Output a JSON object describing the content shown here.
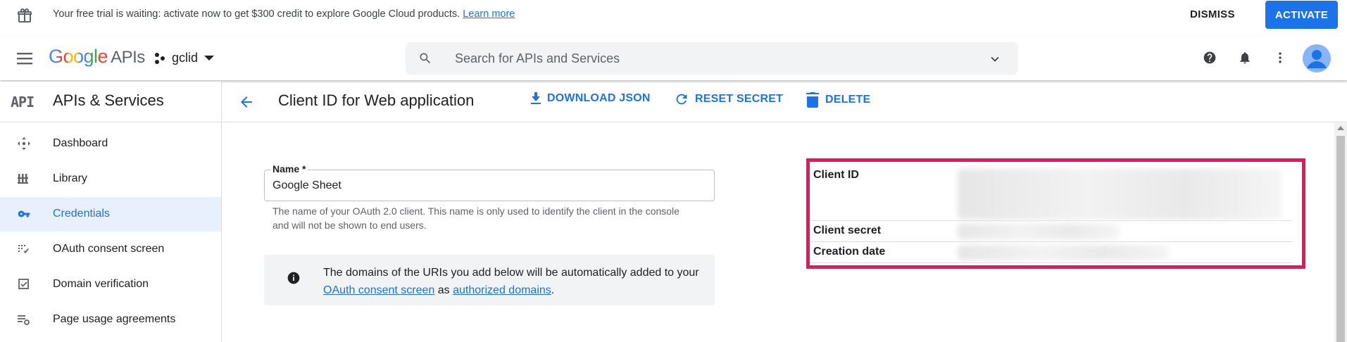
{
  "banner": {
    "message": "Your free trial is waiting: activate now to get $300 credit to explore Google Cloud products.",
    "learn_more": "Learn more",
    "dismiss": "DISMISS",
    "activate": "ACTIVATE"
  },
  "appbar": {
    "logo_google": "Google",
    "logo_apis": "APIs",
    "project_name": "gclid",
    "search_placeholder": "Search for APIs and Services"
  },
  "sidebar": {
    "api_badge": "API",
    "title": "APIs & Services",
    "items": [
      {
        "label": "Dashboard",
        "icon": "dashboard-icon"
      },
      {
        "label": "Library",
        "icon": "library-icon"
      },
      {
        "label": "Credentials",
        "icon": "key-icon",
        "active": true
      },
      {
        "label": "OAuth consent screen",
        "icon": "consent-icon"
      },
      {
        "label": "Domain verification",
        "icon": "checkbox-icon"
      },
      {
        "label": "Page usage agreements",
        "icon": "settings-list-icon"
      }
    ]
  },
  "page": {
    "title": "Client ID for Web application",
    "actions": {
      "download": "DOWNLOAD JSON",
      "reset": "RESET SECRET",
      "delete": "DELETE"
    }
  },
  "form": {
    "name_label": "Name *",
    "name_value": "Google Sheet",
    "help_text": "The name of your OAuth 2.0 client. This name is only used to identify the client in the console and will not be shown to end users.",
    "info_pre": "The domains of the URIs you add below will be automatically added to your",
    "info_link1": "OAuth consent screen",
    "info_mid": "as",
    "info_link2": "authorized domains",
    "info_post": "."
  },
  "details": {
    "client_id_label": "Client ID",
    "client_secret_label": "Client secret",
    "creation_date_label": "Creation date"
  },
  "colors": {
    "accent": "#1a73e8",
    "highlight": "#e8175d",
    "active_bg": "#e8f0fe"
  }
}
